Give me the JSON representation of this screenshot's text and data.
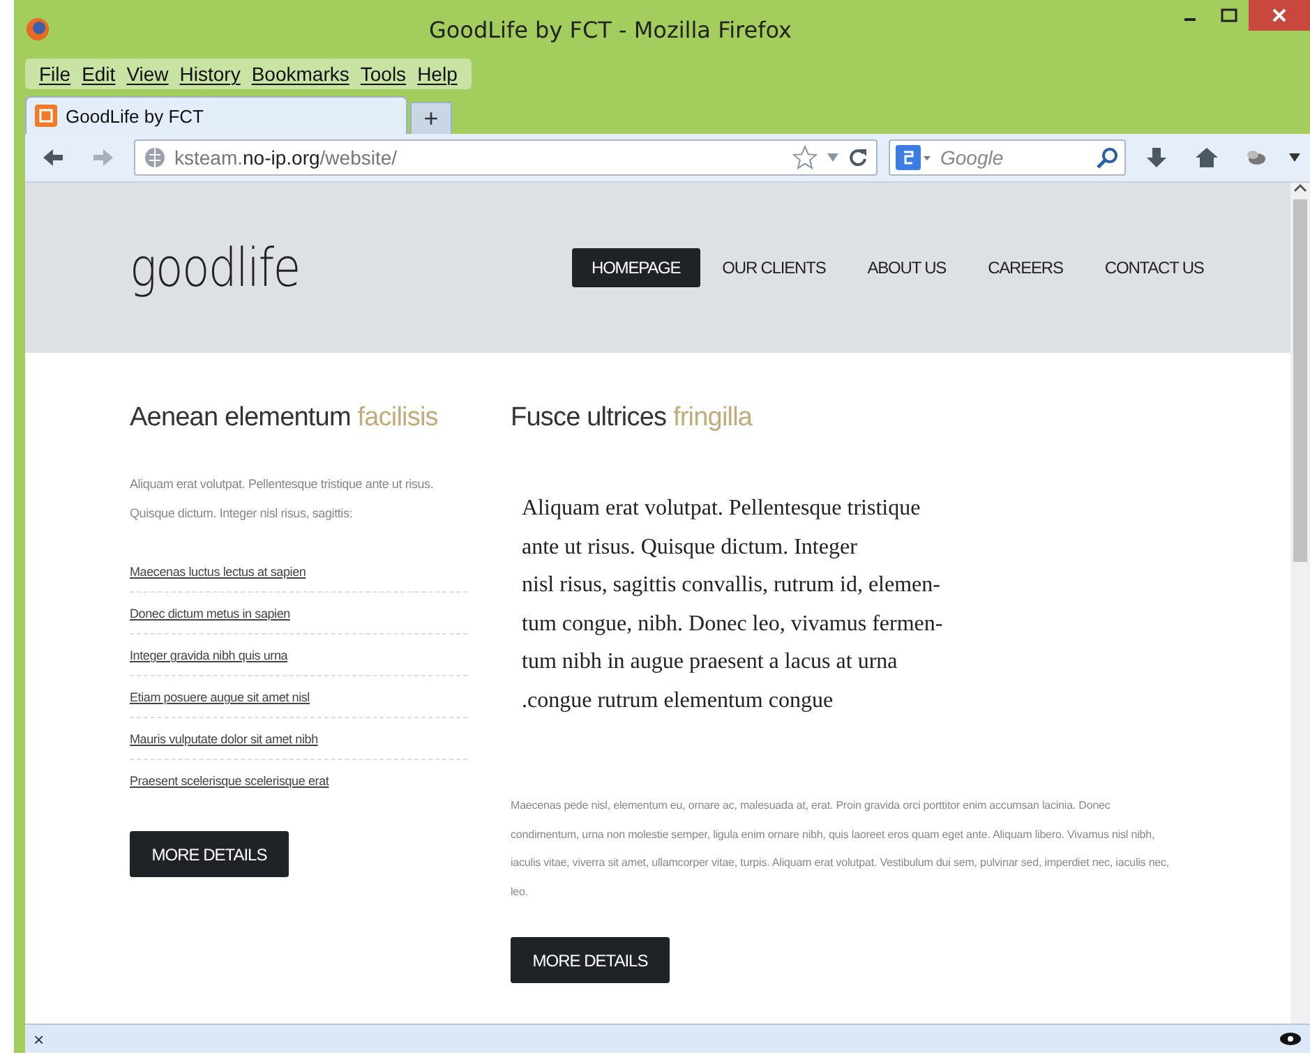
{
  "window": {
    "title": "GoodLife by FCT - Mozilla Firefox"
  },
  "menu": [
    "File",
    "Edit",
    "View",
    "History",
    "Bookmarks",
    "Tools",
    "Help"
  ],
  "tabs": [
    {
      "label": "GoodLife by FCT",
      "selected": true
    }
  ],
  "new_tab": "+",
  "address": {
    "prefix": "ksteam.",
    "domain": "no-ip.org",
    "path": "/website/"
  },
  "search": {
    "placeholder": "Google"
  },
  "site": {
    "logo": "goodlife",
    "nav": [
      {
        "label": "HOMEPAGE",
        "selected": true
      },
      {
        "label": "OUR CLIENTS",
        "selected": false
      },
      {
        "label": "ABOUT US",
        "selected": false
      },
      {
        "label": "CAREERS",
        "selected": false
      },
      {
        "label": "CONTACT US",
        "selected": false
      }
    ],
    "left": {
      "heading": "Aenean elementum",
      "accent": "facilisis",
      "intro": "Aliquam erat volutpat. Pellentesque tristique ante ut risus. Quisque dictum. Integer nisl risus, sagittis:",
      "links": [
        "Maecenas luctus lectus at sapien",
        "Donec dictum metus in sapien",
        "Integer gravida nibh quis urna",
        "Etiam posuere augue sit amet nisl",
        "Mauris vulputate dolor sit amet nibh",
        "Praesent scelerisque scelerisque erat"
      ],
      "button": "MORE DETAILS"
    },
    "right": {
      "heading": "Fusce ultrices",
      "accent": "fringilla",
      "lines": [
        "Aliquam erat volutpat. Pellentesque tristique",
        "ante ut risus. Quisque dictum. Integer",
        "nisl risus, sagittis convallis, rutrum id, elemen-",
        "tum congue, nibh. Donec leo, vivamus fermen-",
        "tum nibh in augue praesent a lacus at urna",
        ".congue rutrum elementum congue"
      ],
      "body": "Maecenas pede nisl, elementum eu, ornare ac, malesuada at, erat. Proin gravida orci porttitor enim accumsan lacinia. Donec condimentum, urna non molestie semper, ligula enim ornare nibh, quis laoreet eros quam eget ante. Aliquam libero. Vivamus nisl nibh, iaculis vitae, viverra sit amet, ullamcorper vitae, turpis. Aliquam erat volutpat. Vestibulum dui sem, pulvinar sed, imperdiet nec, iaculis nec, leo.",
      "button": "MORE DETAILS"
    }
  },
  "status_bar": {
    "close": "×"
  }
}
